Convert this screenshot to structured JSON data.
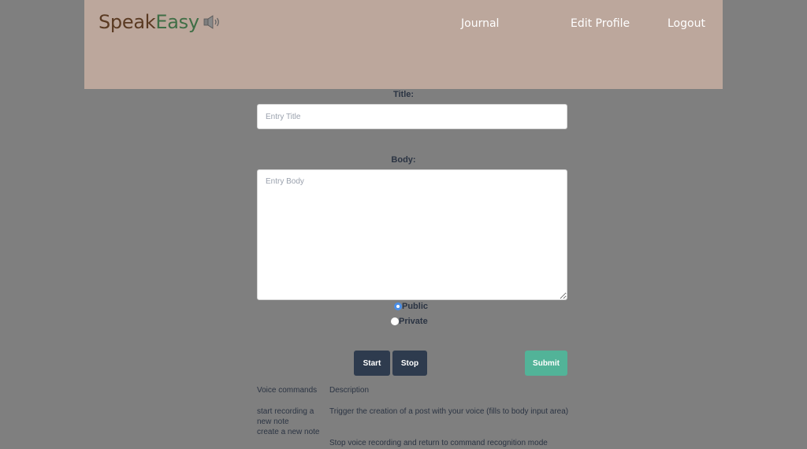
{
  "header": {
    "brand_speak": "Speak",
    "brand_easy": "Easy",
    "brand_icon": "speaker-icon",
    "nav": {
      "journal": "Journal",
      "edit_profile": "Edit Profile",
      "logout": "Logout"
    }
  },
  "form": {
    "title_label": "Title:",
    "title_placeholder": "Entry Title",
    "body_label": "Body:",
    "body_placeholder": "Entry Body",
    "visibility": {
      "public_label": "Public",
      "private_label": "Private",
      "selected": "Public"
    },
    "buttons": {
      "start": "Start",
      "stop": "Stop",
      "submit": "Submit"
    }
  },
  "commands": {
    "header_command": "Voice commands",
    "header_description": "Description",
    "rows": [
      {
        "command": "start recording a new note\ncreate a new note",
        "description": "Trigger the creation of a post with your voice (fills to body input area)"
      },
      {
        "command": "",
        "description": "Stop voice recording and return to command recognition mode"
      }
    ]
  },
  "colors": {
    "background": "#7f7f7f",
    "header_bg": "#bca79c",
    "brand_brown": "#5a3a22",
    "brand_green": "#3f6e46",
    "button_dark": "#2e3b4e",
    "button_green": "#52b398",
    "radio_selected": "#4a8ee6"
  }
}
